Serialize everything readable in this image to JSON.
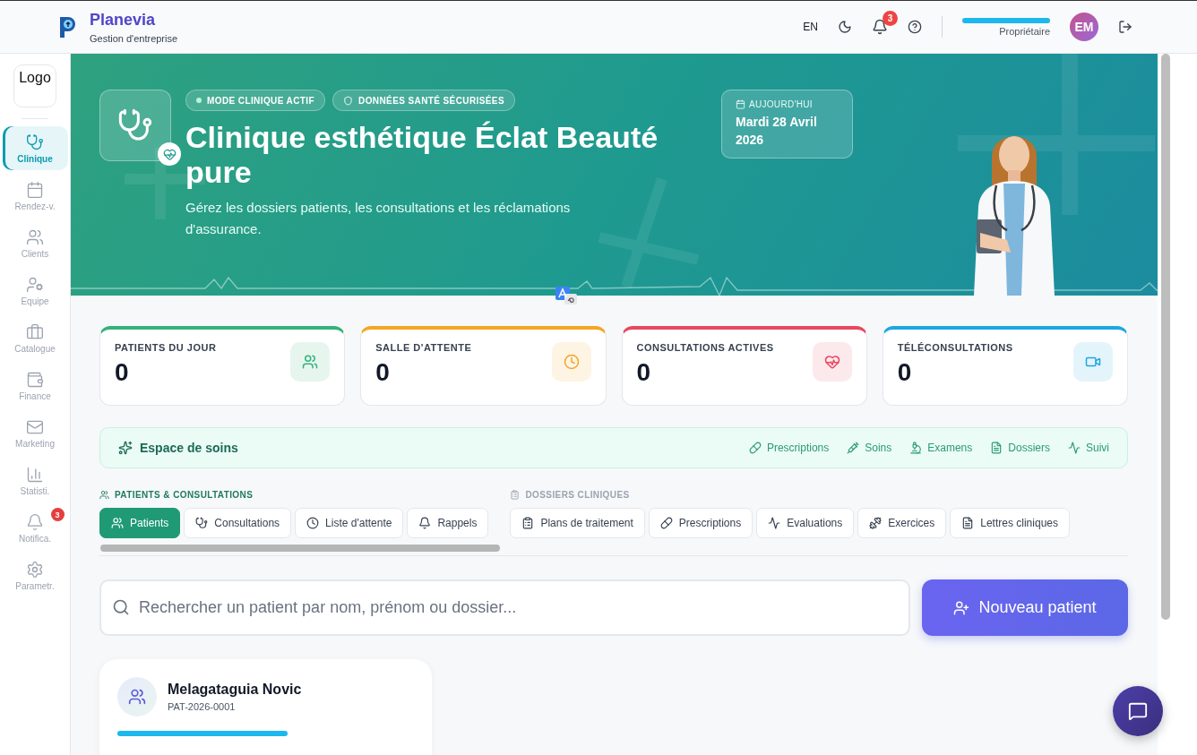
{
  "header": {
    "brand": "Planevia",
    "tagline": "Gestion d'entreprise",
    "language": "EN",
    "notification_count": "3",
    "user_role": "Propriétaire",
    "avatar_initials": "EM"
  },
  "sidebar": {
    "logo": "Logo",
    "items": [
      {
        "label": "Clinique",
        "selected": true
      },
      {
        "label": "Rendez-v.",
        "selected": false
      },
      {
        "label": "Clients",
        "selected": false
      },
      {
        "label": "Equipe",
        "selected": false
      },
      {
        "label": "Catalogue",
        "selected": false
      },
      {
        "label": "Finance",
        "selected": false
      },
      {
        "label": "Marketing",
        "selected": false
      },
      {
        "label": "Statisti.",
        "selected": false
      },
      {
        "label": "Notifica.",
        "selected": false,
        "badge": "3"
      },
      {
        "label": "Parametr.",
        "selected": false
      }
    ]
  },
  "hero": {
    "chips": [
      "MODE CLINIQUE ACTIF",
      "DONNÉES SANTÉ SÉCURISÉES"
    ],
    "title": "Clinique esthétique Éclat Beauté pure",
    "subtitle": "Gérez les dossiers patients, les consultations et les réclamations d'assurance.",
    "date_label": "AUJOURD'HUI",
    "date": "Mardi 28 Avril 2026"
  },
  "stats": [
    {
      "label": "PATIENTS DU JOUR",
      "value": "0",
      "color": "#34b27b"
    },
    {
      "label": "SALLE D'ATTENTE",
      "value": "0",
      "color": "#f5a524"
    },
    {
      "label": "CONSULTATIONS ACTIVES",
      "value": "0",
      "color": "#e8475f"
    },
    {
      "label": "TÉLÉCONSULTATIONS",
      "value": "0",
      "color": "#1ea7e1"
    }
  ],
  "care_bar": {
    "title": "Espace de soins",
    "links": [
      "Prescriptions",
      "Soins",
      "Examens",
      "Dossiers",
      "Suivi"
    ]
  },
  "tab_groups": [
    {
      "label": "PATIENTS & CONSULTATIONS",
      "selected": true,
      "tabs": [
        {
          "label": "Patients",
          "selected": true
        },
        {
          "label": "Consultations",
          "selected": false
        },
        {
          "label": "Liste d'attente",
          "selected": false
        },
        {
          "label": "Rappels",
          "selected": false
        }
      ]
    },
    {
      "label": "DOSSIERS CLINIQUES",
      "selected": false,
      "tabs": [
        {
          "label": "Plans de traitement",
          "selected": false
        },
        {
          "label": "Prescriptions",
          "selected": false
        },
        {
          "label": "Evaluations",
          "selected": false
        },
        {
          "label": "Exercices",
          "selected": false
        },
        {
          "label": "Lettres cliniques",
          "selected": false
        }
      ]
    }
  ],
  "search": {
    "placeholder": "Rechercher un patient par nom, prénom ou dossier..."
  },
  "new_patient_button": "Nouveau patient",
  "patients": [
    {
      "name": "Melagataguia Novic",
      "id": "PAT-2026-0001"
    }
  ]
}
